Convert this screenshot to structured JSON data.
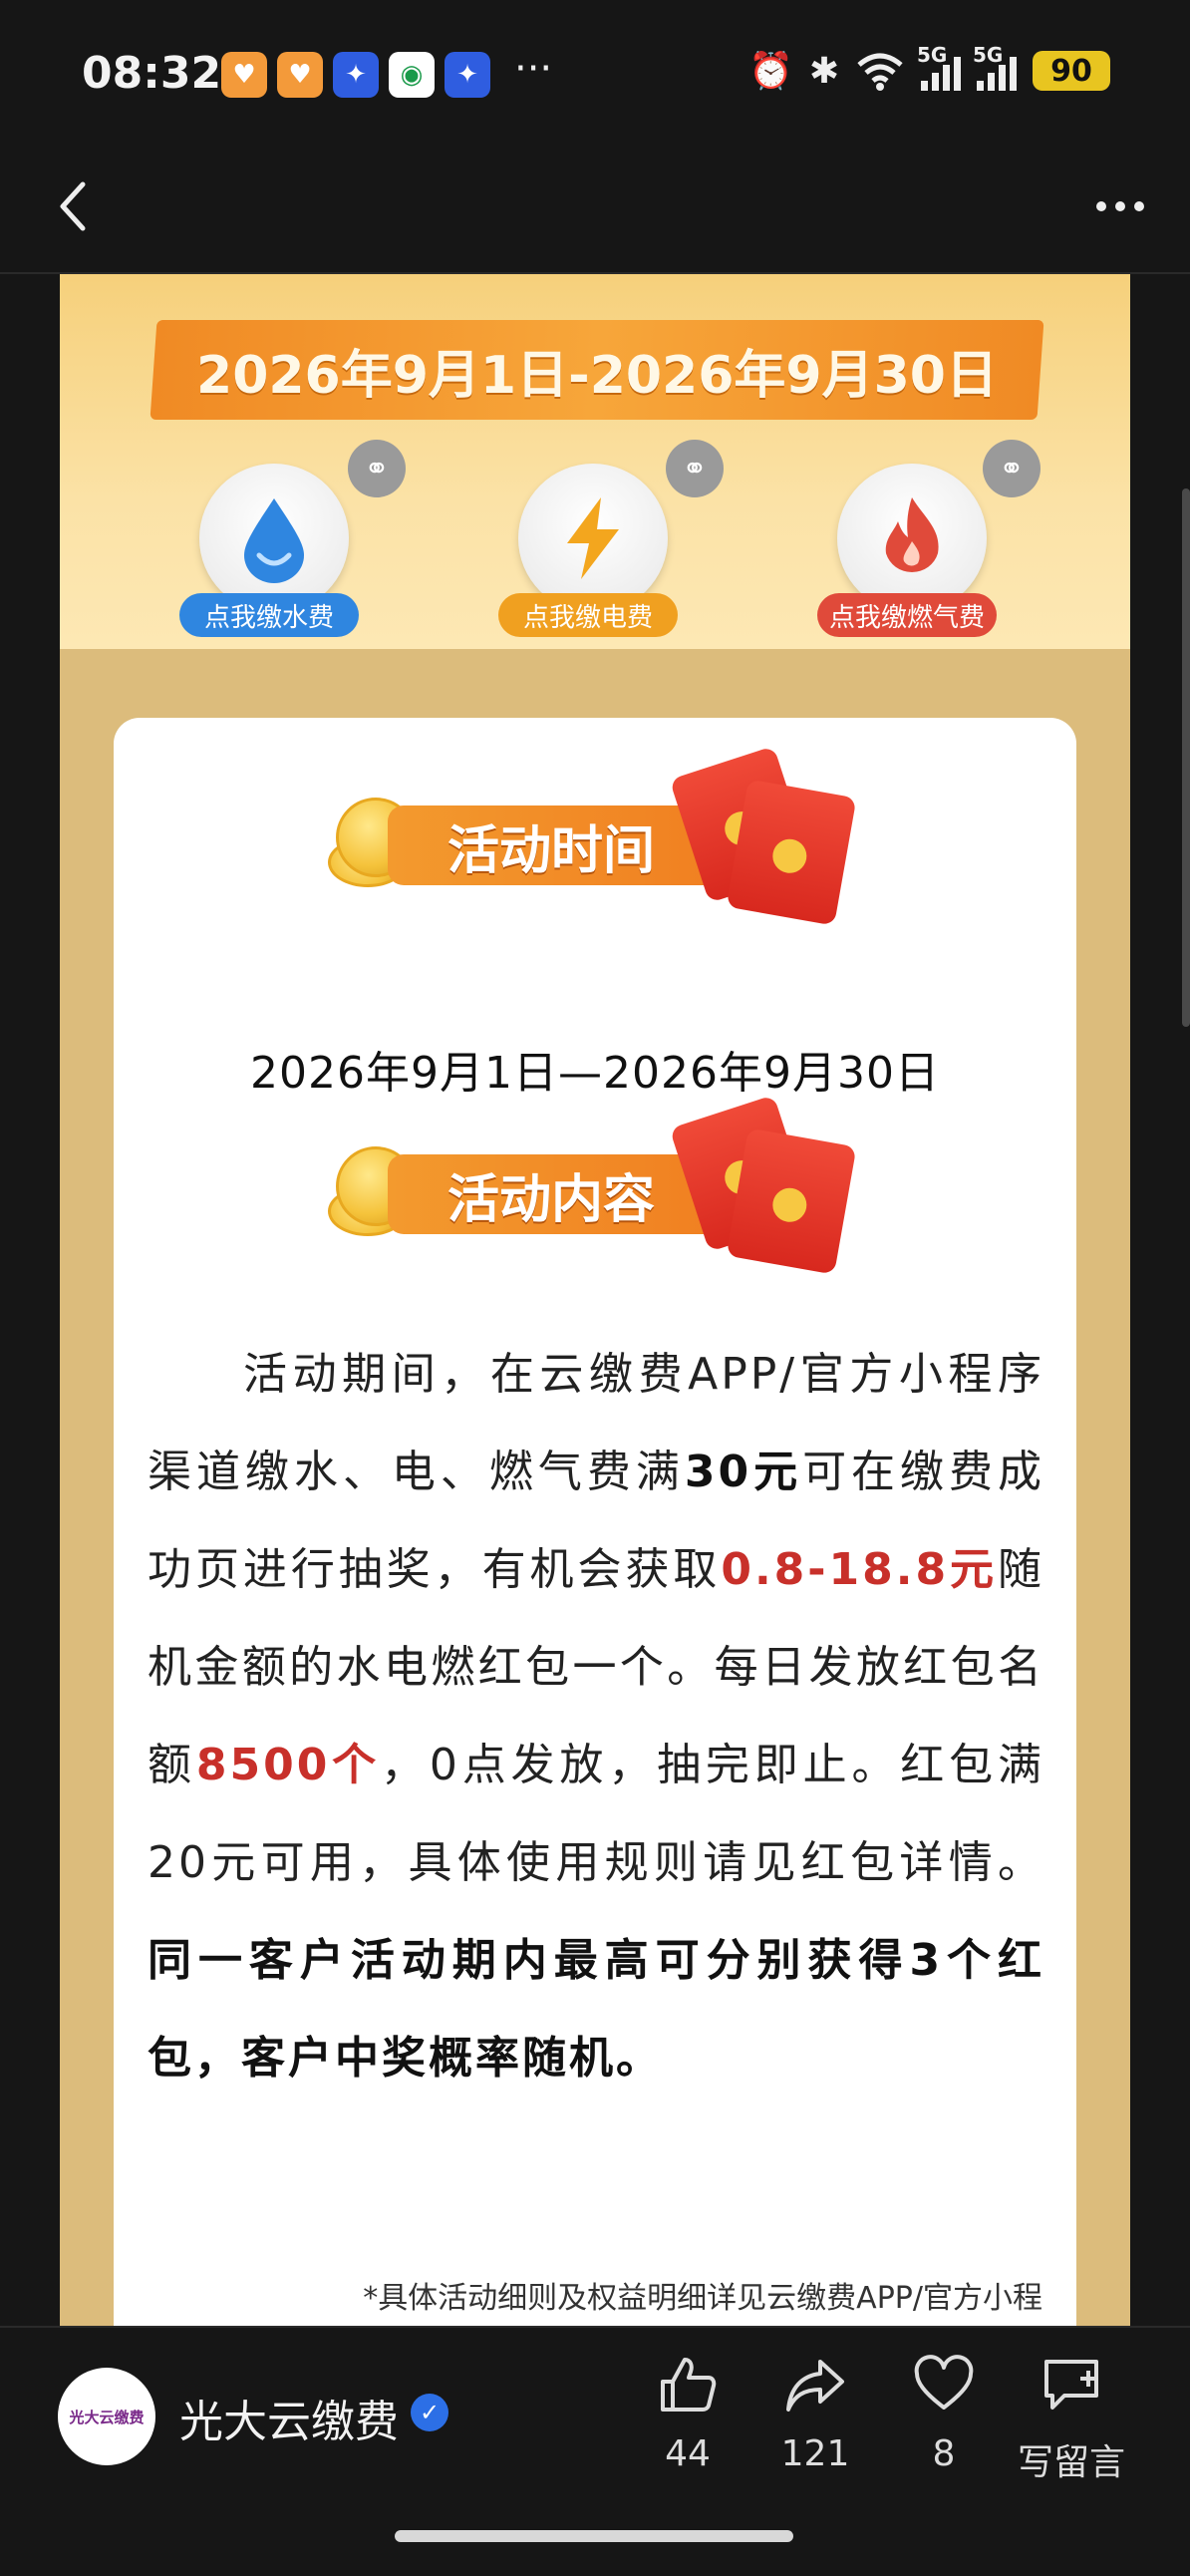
{
  "status_bar": {
    "time": "08:32",
    "network_tag_1": "5G",
    "network_tag_2": "5G",
    "battery": "90",
    "more": "···",
    "notif_icons": [
      "app-heart-icon",
      "app-heart-icon",
      "app-star-icon",
      "china-mobile-icon",
      "app-star-icon"
    ]
  },
  "nav": {
    "back_icon": "chevron-left-icon",
    "more_icon": "more-dots-icon"
  },
  "banner": {
    "date_range": "2026年9月1日-2026年9月30日",
    "services": [
      {
        "label": "点我缴水费",
        "icon": "water-drop-icon",
        "color": "#2f86e0"
      },
      {
        "label": "点我缴电费",
        "icon": "lightning-icon",
        "color": "#f0a020"
      },
      {
        "label": "点我缴燃气费",
        "icon": "flame-icon",
        "color": "#e04a3a"
      }
    ]
  },
  "card": {
    "time_title": "活动时间",
    "time_value": "2026年9月1日—2026年9月30日",
    "content_title": "活动内容",
    "body": {
      "p1": "活动期间，在云缴费APP/官方小程序渠道缴水、电、燃气费满",
      "amount_min": "30元",
      "p2": "可在缴费成功页进行抽奖，有机会获取",
      "prize_range": "0.8-18.8元",
      "p3": "随机金额的水电燃红包一个。每日发放红包名额",
      "quota": "8500个",
      "p4": "，0点发放，抽完即止。红包满20元可用，具体使用规则请见红包详情。",
      "p5_bold": "同一客户活动期内最高可分别获得3个红包，客户中奖概率随机。"
    },
    "footnote": "*具体活动细则及权益明细详见云缴费APP/官方小程"
  },
  "bottom_bar": {
    "avatar_text": "光大云缴费",
    "account_name": "光大云缴费",
    "actions": [
      {
        "icon": "thumbs-up-icon",
        "count": "44"
      },
      {
        "icon": "share-icon",
        "count": "121"
      },
      {
        "icon": "heart-icon",
        "count": "8"
      },
      {
        "icon": "comment-add-icon",
        "label": "写留言"
      }
    ]
  }
}
